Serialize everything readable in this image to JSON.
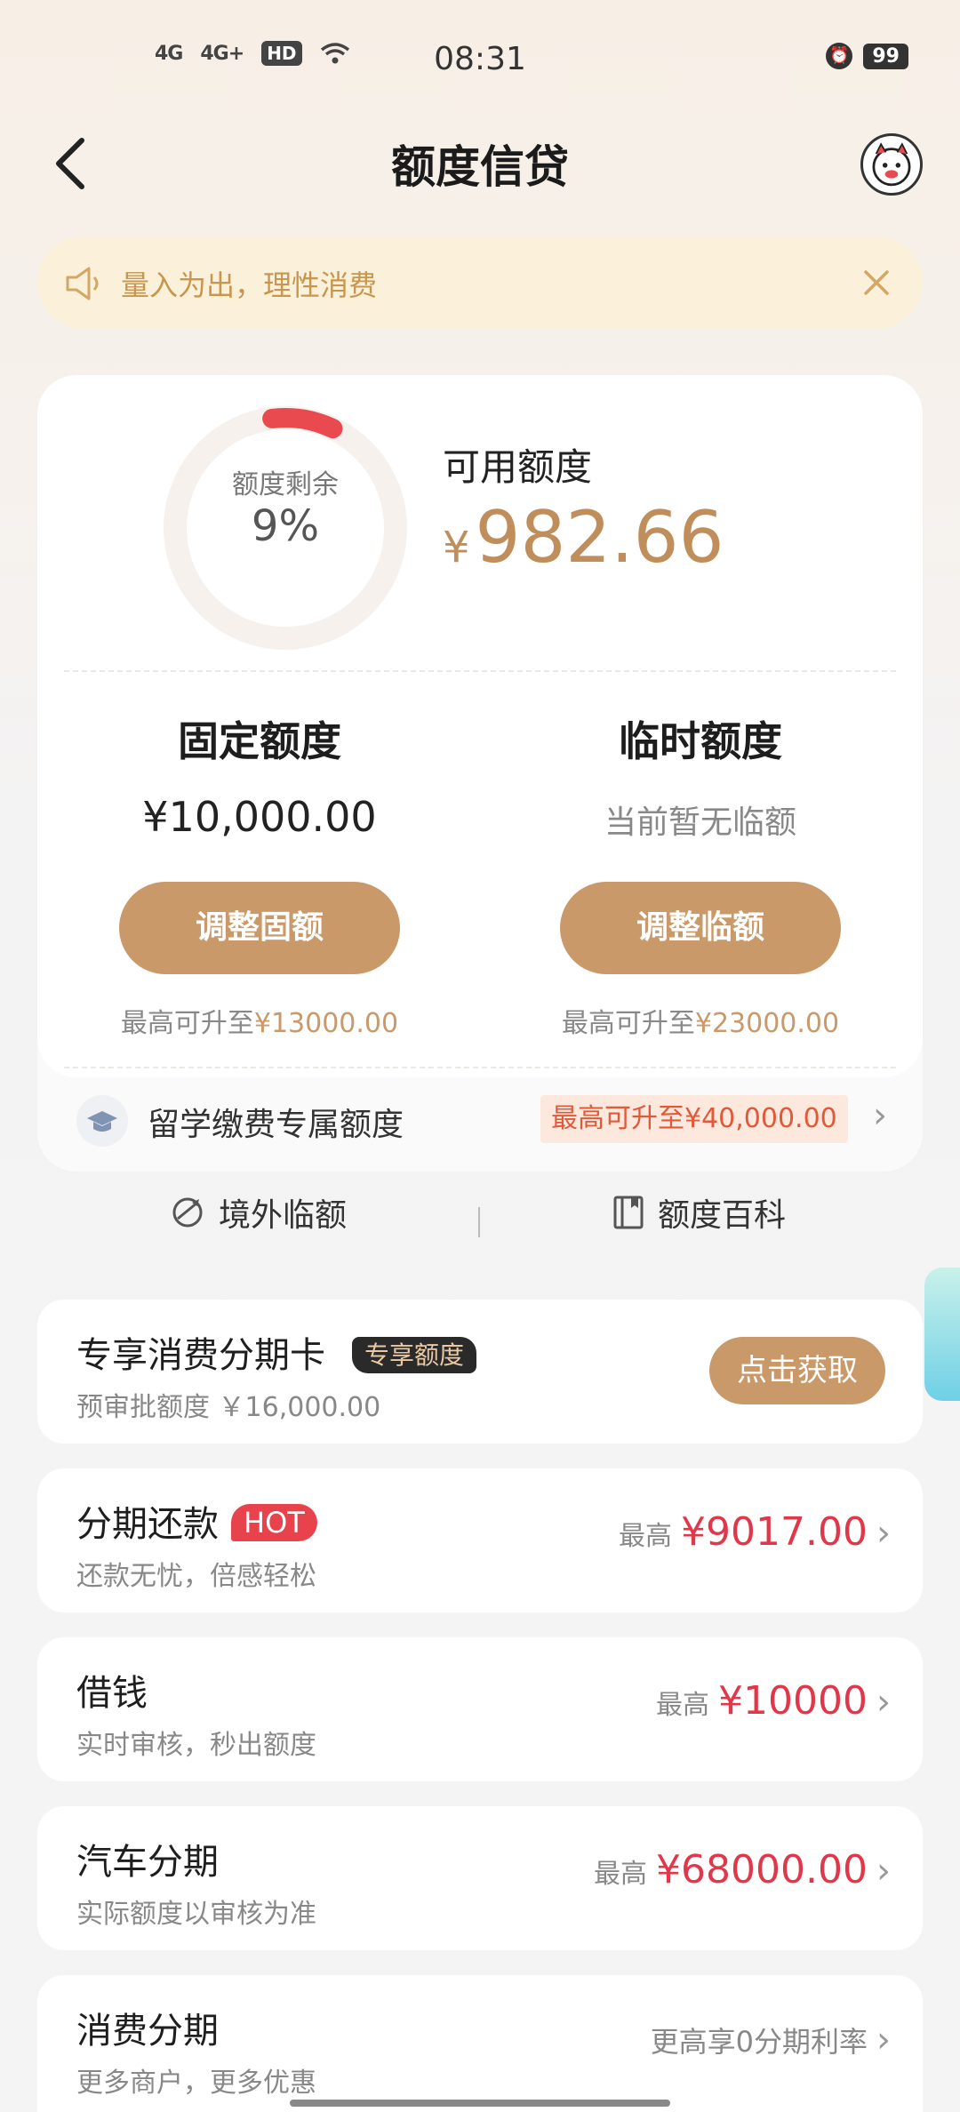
{
  "status_bar": {
    "net1": "4G",
    "net2": "4G+",
    "hd": "HD",
    "time": "08:31",
    "battery": "99"
  },
  "header": {
    "title": "额度信贷"
  },
  "notice": {
    "text": "量入为出，理性消费"
  },
  "credit": {
    "ring_label": "额度剩余",
    "ring_value": "9%",
    "remaining_fraction": 0.09,
    "available_label": "可用额度",
    "available_currency": "¥",
    "available_amount": "982.66",
    "fixed": {
      "title": "固定额度",
      "amount": "¥10,000.00",
      "button": "调整固额",
      "note_prefix": "最高可升至",
      "note_value": "¥13000.00"
    },
    "temporary": {
      "title": "临时额度",
      "status": "当前暂无临额",
      "button": "调整临额",
      "note_prefix": "最高可升至",
      "note_value": "¥23000.00"
    },
    "study": {
      "label": "留学缴费专属额度",
      "badge": "最高可升至¥40,000.00"
    },
    "sub_links": {
      "overseas": "境外临额",
      "wiki": "额度百科"
    }
  },
  "cards": {
    "exclusive": {
      "title": "专享消费分期卡",
      "badge": "专享额度",
      "subtitle": "预审批额度 ￥16,000.00",
      "button": "点击获取"
    },
    "installment": {
      "title": "分期还款",
      "badge": "HOT",
      "subtitle": "还款无忧，倍感轻松",
      "prefix": "最高",
      "amount": "¥9017.00"
    },
    "borrow": {
      "title": "借钱",
      "subtitle": "实时审核，秒出额度",
      "prefix": "最高",
      "amount": "¥10000"
    },
    "car": {
      "title": "汽车分期",
      "subtitle": "实际额度以审核为准",
      "prefix": "最高",
      "amount": "¥68000.00"
    },
    "consumer": {
      "title": "消费分期",
      "subtitle": "更多商户，更多优惠",
      "rate": "更高享0分期利率"
    }
  },
  "colors": {
    "accent_gold": "#c9996a",
    "amount_red": "#e0384a",
    "ring_red": "#e84a4f"
  }
}
